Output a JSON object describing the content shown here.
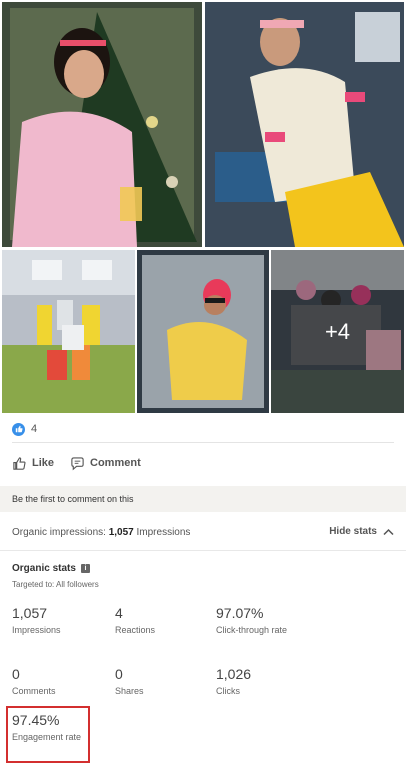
{
  "post": {
    "more_photos_label": "+4",
    "reaction_count": "4",
    "like_label": "Like",
    "comment_label": "Comment",
    "first_comment_prompt": "Be the first to comment on this"
  },
  "impressions_bar": {
    "prefix": "Organic impressions: ",
    "count": "1,057",
    "suffix": " Impressions",
    "toggle_label": "Hide stats"
  },
  "organic_stats": {
    "title": "Organic stats",
    "targeted": "Targeted to: All followers",
    "items": [
      {
        "value": "1,057",
        "label": "Impressions"
      },
      {
        "value": "4",
        "label": "Reactions"
      },
      {
        "value": "97.07%",
        "label": "Click-through rate"
      },
      {
        "value": "0",
        "label": "Comments"
      },
      {
        "value": "0",
        "label": "Shares"
      },
      {
        "value": "1,026",
        "label": "Clicks"
      },
      {
        "value": "97.45%",
        "label": "Engagement rate"
      }
    ]
  },
  "colors": {
    "accent_blue": "#378fe9",
    "highlight_red": "#d32f2f"
  }
}
